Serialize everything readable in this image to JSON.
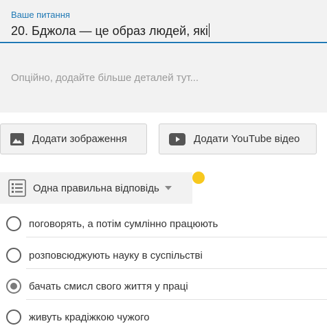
{
  "question": {
    "label": "Ваше питання",
    "value": "20. Бджола — це образ людей, які"
  },
  "details": {
    "placeholder": "Опційно, додайте більше деталей тут..."
  },
  "media": {
    "add_image_label": "Додати зображення",
    "add_youtube_label": "Додати YouTube відео"
  },
  "answer_type": {
    "label": "Одна правильна відповідь"
  },
  "options": [
    {
      "text": "поговорять, а потім сумлінно працюють",
      "checked": false
    },
    {
      "text": "розповсюджують науку в суспільстві",
      "checked": false
    },
    {
      "text": "бачать смисл свого життя у праці",
      "checked": true
    },
    {
      "text": "живуть крадіжкою чужого",
      "checked": false
    }
  ],
  "colors": {
    "accent": "#1f78b4",
    "indicator": "#f7c81e",
    "panel": "#f2f2f2"
  }
}
